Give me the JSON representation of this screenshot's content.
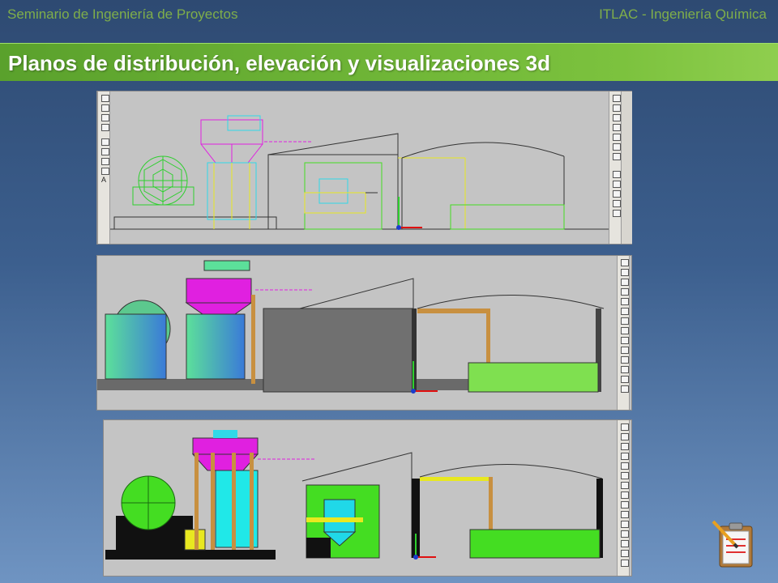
{
  "header": {
    "left_text": "Seminario de Ingeniería de Proyectos",
    "right_text": "ITLAC - Ingeniería Química"
  },
  "title": "Planos de distribución, elevación y visualizaciones 3d",
  "left_toolbar_letter": "A",
  "panels": [
    {
      "name": "plan-2d-wireframe"
    },
    {
      "name": "elevation-shaded"
    },
    {
      "name": "visualization-3d"
    }
  ],
  "colors": {
    "title_bar": "#6cb535",
    "header_text": "#7fae4a",
    "cad_background": "#c4c4c4",
    "magenta": "#e020e0",
    "cyan": "#30d8e8",
    "green": "#44dd22",
    "yellow": "#e8e820"
  },
  "icons": [
    "clipboard-pencil-icon",
    "ucs-axis-icon",
    "cad-toolbar-icons"
  ]
}
